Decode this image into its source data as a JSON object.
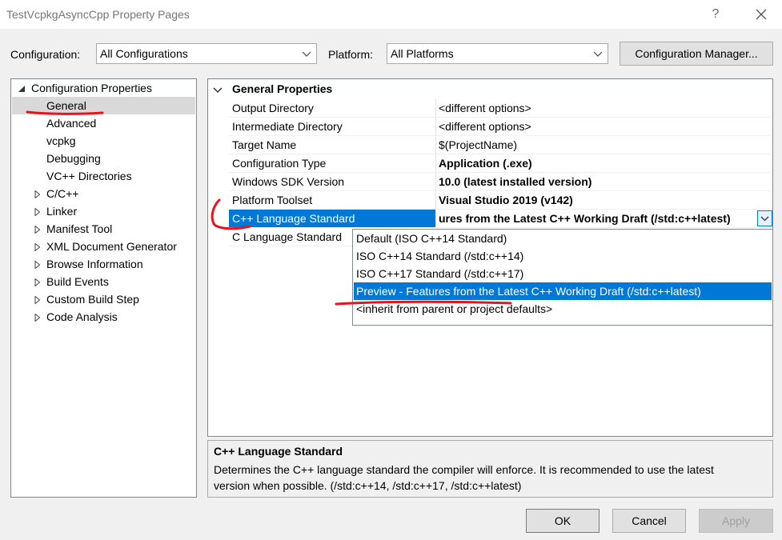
{
  "window": {
    "title": "TestVcpkgAsyncCpp Property Pages",
    "help_glyph": "?",
    "close_glyph": "✕"
  },
  "toolbar": {
    "configuration_label": "Configuration:",
    "configuration_value": "All Configurations",
    "platform_label": "Platform:",
    "platform_value": "All Platforms",
    "config_manager_label": "Configuration Manager..."
  },
  "tree": {
    "root": "Configuration Properties",
    "items": [
      {
        "label": "General"
      },
      {
        "label": "Advanced"
      },
      {
        "label": "vcpkg"
      },
      {
        "label": "Debugging"
      },
      {
        "label": "VC++ Directories"
      },
      {
        "label": "C/C++"
      },
      {
        "label": "Linker"
      },
      {
        "label": "Manifest Tool"
      },
      {
        "label": "XML Document Generator"
      },
      {
        "label": "Browse Information"
      },
      {
        "label": "Build Events"
      },
      {
        "label": "Custom Build Step"
      },
      {
        "label": "Code Analysis"
      }
    ]
  },
  "grid": {
    "section": "General Properties",
    "rows": [
      {
        "name": "Output Directory",
        "value": "<different options>"
      },
      {
        "name": "Intermediate Directory",
        "value": "<different options>"
      },
      {
        "name": "Target Name",
        "value": "$(ProjectName)"
      },
      {
        "name": "Configuration Type",
        "value": "Application (.exe)"
      },
      {
        "name": "Windows SDK Version",
        "value": "10.0 (latest installed version)"
      },
      {
        "name": "Platform Toolset",
        "value": "Visual Studio 2019 (v142)"
      },
      {
        "name": "C++ Language Standard",
        "value": "ures from the Latest C++ Working Draft (/std:c++latest)"
      },
      {
        "name": "C Language Standard",
        "value": ""
      }
    ]
  },
  "dropdown": {
    "options": [
      "Default (ISO C++14 Standard)",
      "ISO C++14 Standard (/std:c++14)",
      "ISO C++17 Standard (/std:c++17)",
      "Preview - Features from the Latest C++ Working Draft (/std:c++latest)",
      "<inherit from parent or project defaults>"
    ],
    "selected": "Preview - Features from the Latest C++ Working Draft (/std:c++latest)"
  },
  "description": {
    "title": "C++ Language Standard",
    "text_line1": "Determines the C++ language standard the compiler will enforce. It is recommended to use the latest",
    "text_line2": "version when possible.  (/std:c++14, /std:c++17, /std:c++latest)"
  },
  "buttons": {
    "ok": "OK",
    "cancel": "Cancel",
    "apply": "Apply"
  },
  "colors": {
    "selection": "#0078d7",
    "annotation": "#e8141c"
  }
}
